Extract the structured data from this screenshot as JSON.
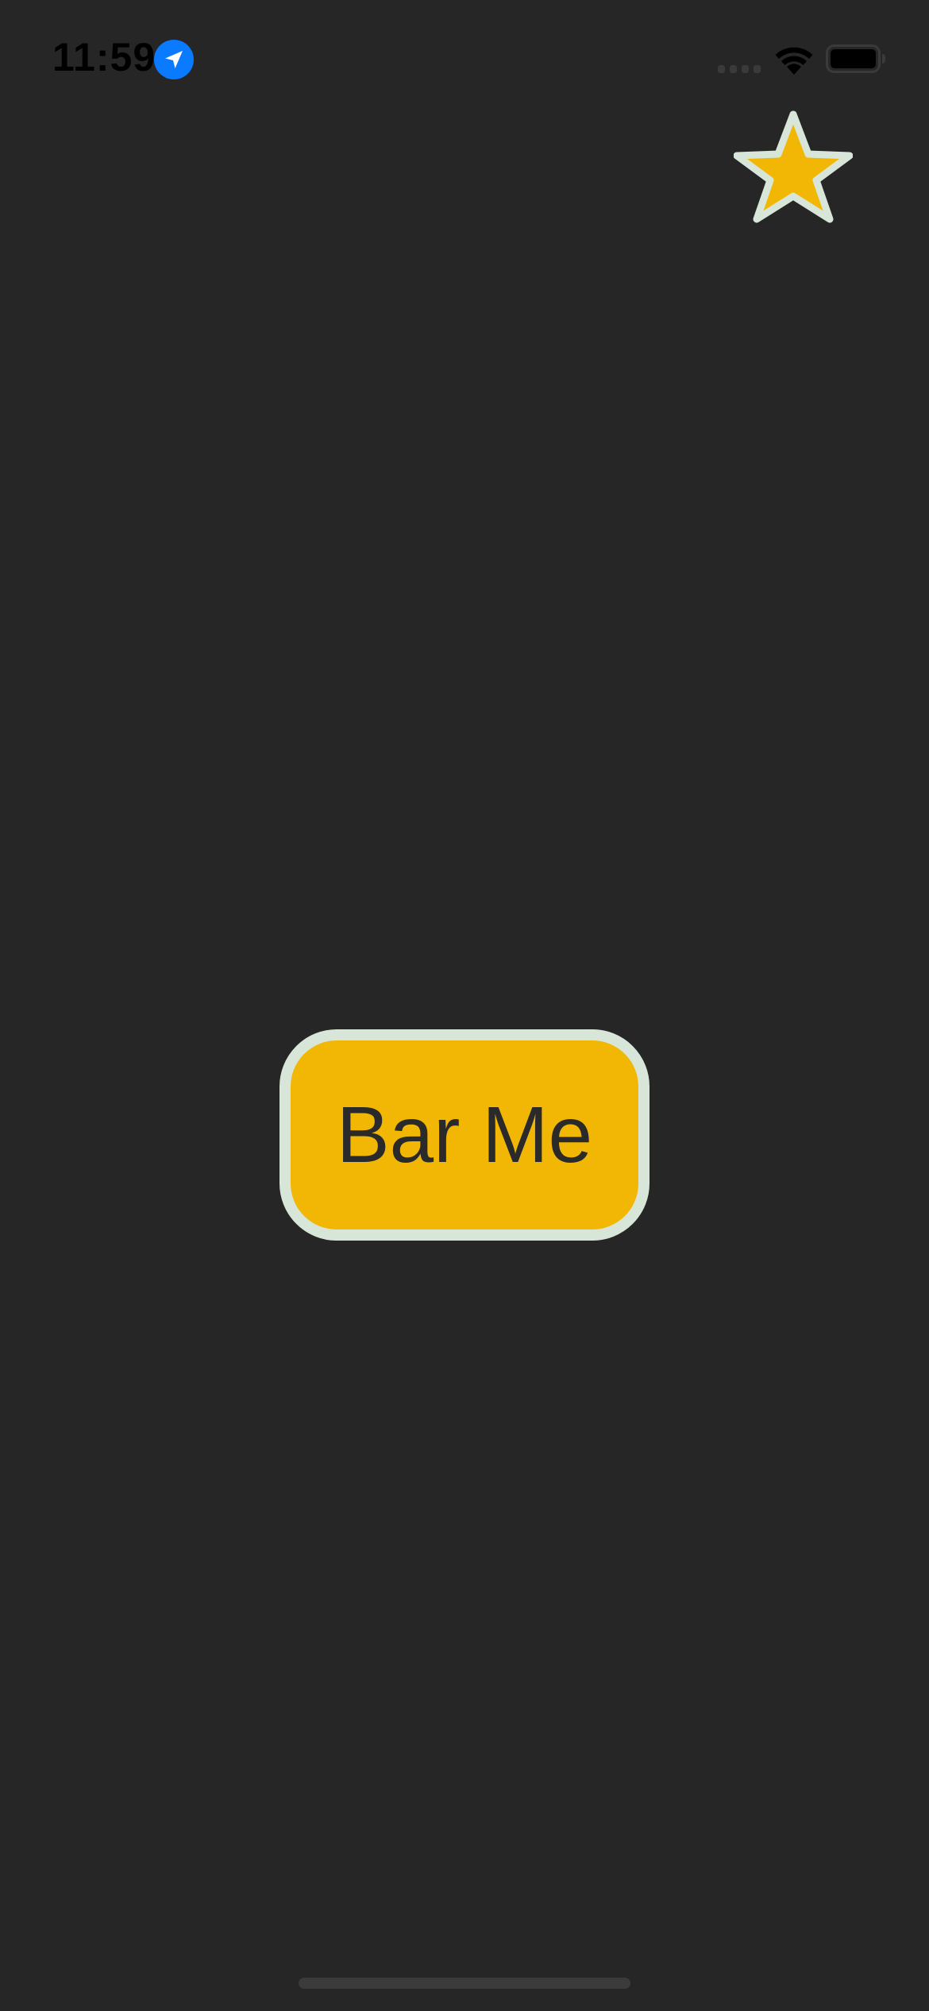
{
  "status_bar": {
    "time": "11:59",
    "location_icon": "location-arrow-icon",
    "signal_icon": "cellular-signal-icon",
    "wifi_icon": "wifi-icon",
    "battery_icon": "battery-full-icon"
  },
  "favorite": {
    "icon": "star-icon",
    "fill_color": "#f2b705",
    "stroke_color": "#d7e6d8"
  },
  "main_button": {
    "label": "Bar Me",
    "background_color": "#f2b705",
    "border_color": "#d7e6d8",
    "text_color": "#2a2a2a"
  },
  "colors": {
    "background": "#262626",
    "accent_blue": "#0a7aff"
  }
}
